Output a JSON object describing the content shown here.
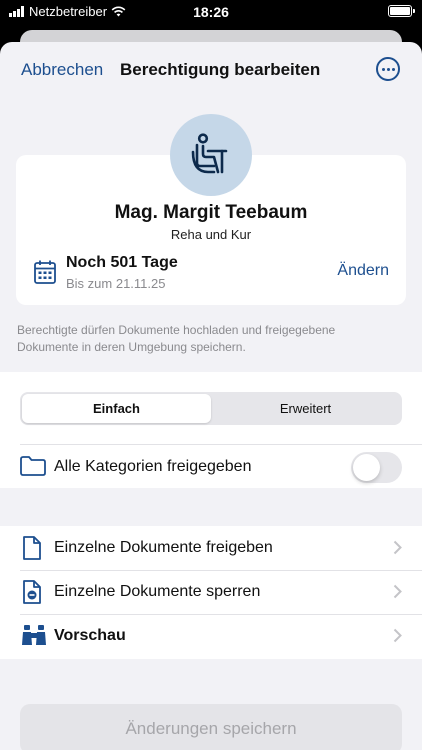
{
  "status_bar": {
    "carrier": "Netzbetreiber",
    "time": "18:26"
  },
  "nav": {
    "cancel_label": "Abbrechen",
    "title": "Berechtigung bearbeiten"
  },
  "person": {
    "name": "Mag. Margit Teebaum",
    "subtitle": "Reha und Kur"
  },
  "validity": {
    "title": "Noch 501 Tage",
    "until": "Bis zum 21.11.25",
    "change_label": "Ändern"
  },
  "info_text": "Berechtigte dürfen Dokumente hochladen und freigegebene Dokumente in deren Umgebung speichern.",
  "segmented": {
    "options": [
      "Einfach",
      "Erweitert"
    ],
    "selected": "Einfach"
  },
  "categories": {
    "label": "Alle Kategorien freigegeben",
    "enabled": false
  },
  "list": [
    {
      "label": "Einzelne Dokumente freigeben",
      "icon": "document-icon"
    },
    {
      "label": "Einzelne Dokumente sperren",
      "icon": "document-blocked-icon"
    },
    {
      "label": "Vorschau",
      "icon": "binoculars-icon"
    }
  ],
  "save_button": {
    "label": "Änderungen speichern",
    "enabled": false
  },
  "colors": {
    "accent": "#1d4f8f",
    "background": "#f2f2f6",
    "avatar_bg": "#c5d7e8"
  }
}
